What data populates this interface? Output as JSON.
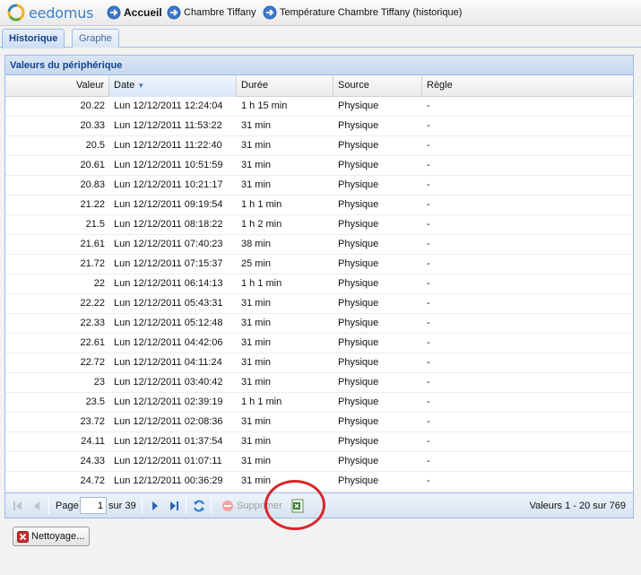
{
  "brand": {
    "logo_text": "eedomus"
  },
  "breadcrumb": {
    "home": "Accueil",
    "room": "Chambre Tiffany",
    "page": "Température Chambre Tiffany (historique)"
  },
  "tabs": [
    {
      "label": "Historique",
      "active": true
    },
    {
      "label": "Graphe",
      "active": false
    }
  ],
  "panel": {
    "title": "Valeurs du périphérique",
    "columns": [
      "Valeur",
      "Date",
      "Durée",
      "Source",
      "Règle"
    ],
    "sorted_column": "Date",
    "rows": [
      {
        "valeur": "20.22",
        "date": "Lun 12/12/2011 12:24:04",
        "duree": "1 h 15 min",
        "source": "Physique",
        "regle": "-"
      },
      {
        "valeur": "20.33",
        "date": "Lun 12/12/2011 11:53:22",
        "duree": "31 min",
        "source": "Physique",
        "regle": "-"
      },
      {
        "valeur": "20.5",
        "date": "Lun 12/12/2011 11:22:40",
        "duree": "31 min",
        "source": "Physique",
        "regle": "-"
      },
      {
        "valeur": "20.61",
        "date": "Lun 12/12/2011 10:51:59",
        "duree": "31 min",
        "source": "Physique",
        "regle": "-"
      },
      {
        "valeur": "20.83",
        "date": "Lun 12/12/2011 10:21:17",
        "duree": "31 min",
        "source": "Physique",
        "regle": "-"
      },
      {
        "valeur": "21.22",
        "date": "Lun 12/12/2011 09:19:54",
        "duree": "1 h 1 min",
        "source": "Physique",
        "regle": "-"
      },
      {
        "valeur": "21.5",
        "date": "Lun 12/12/2011 08:18:22",
        "duree": "1 h 2 min",
        "source": "Physique",
        "regle": "-"
      },
      {
        "valeur": "21.61",
        "date": "Lun 12/12/2011 07:40:23",
        "duree": "38 min",
        "source": "Physique",
        "regle": "-"
      },
      {
        "valeur": "21.72",
        "date": "Lun 12/12/2011 07:15:37",
        "duree": "25 min",
        "source": "Physique",
        "regle": "-"
      },
      {
        "valeur": "22",
        "date": "Lun 12/12/2011 06:14:13",
        "duree": "1 h 1 min",
        "source": "Physique",
        "regle": "-"
      },
      {
        "valeur": "22.22",
        "date": "Lun 12/12/2011 05:43:31",
        "duree": "31 min",
        "source": "Physique",
        "regle": "-"
      },
      {
        "valeur": "22.33",
        "date": "Lun 12/12/2011 05:12:48",
        "duree": "31 min",
        "source": "Physique",
        "regle": "-"
      },
      {
        "valeur": "22.61",
        "date": "Lun 12/12/2011 04:42:06",
        "duree": "31 min",
        "source": "Physique",
        "regle": "-"
      },
      {
        "valeur": "22.72",
        "date": "Lun 12/12/2011 04:11:24",
        "duree": "31 min",
        "source": "Physique",
        "regle": "-"
      },
      {
        "valeur": "23",
        "date": "Lun 12/12/2011 03:40:42",
        "duree": "31 min",
        "source": "Physique",
        "regle": "-"
      },
      {
        "valeur": "23.5",
        "date": "Lun 12/12/2011 02:39:19",
        "duree": "1 h 1 min",
        "source": "Physique",
        "regle": "-"
      },
      {
        "valeur": "23.72",
        "date": "Lun 12/12/2011 02:08:36",
        "duree": "31 min",
        "source": "Physique",
        "regle": "-"
      },
      {
        "valeur": "24.11",
        "date": "Lun 12/12/2011 01:37:54",
        "duree": "31 min",
        "source": "Physique",
        "regle": "-"
      },
      {
        "valeur": "24.33",
        "date": "Lun 12/12/2011 01:07:11",
        "duree": "31 min",
        "source": "Physique",
        "regle": "-"
      },
      {
        "valeur": "24.72",
        "date": "Lun 12/12/2011 00:36:29",
        "duree": "31 min",
        "source": "Physique",
        "regle": "-"
      }
    ]
  },
  "pager": {
    "page_label": "Page",
    "page_value": "1",
    "of_label": "sur 39",
    "delete_label": "Supprimer",
    "summary": "Valeurs 1 - 20 sur 769"
  },
  "footer": {
    "clean_button": "Nettoyage..."
  },
  "colors": {
    "accent": "#15428b",
    "panel_border": "#99bbe8",
    "annotation": "#d9262a"
  }
}
